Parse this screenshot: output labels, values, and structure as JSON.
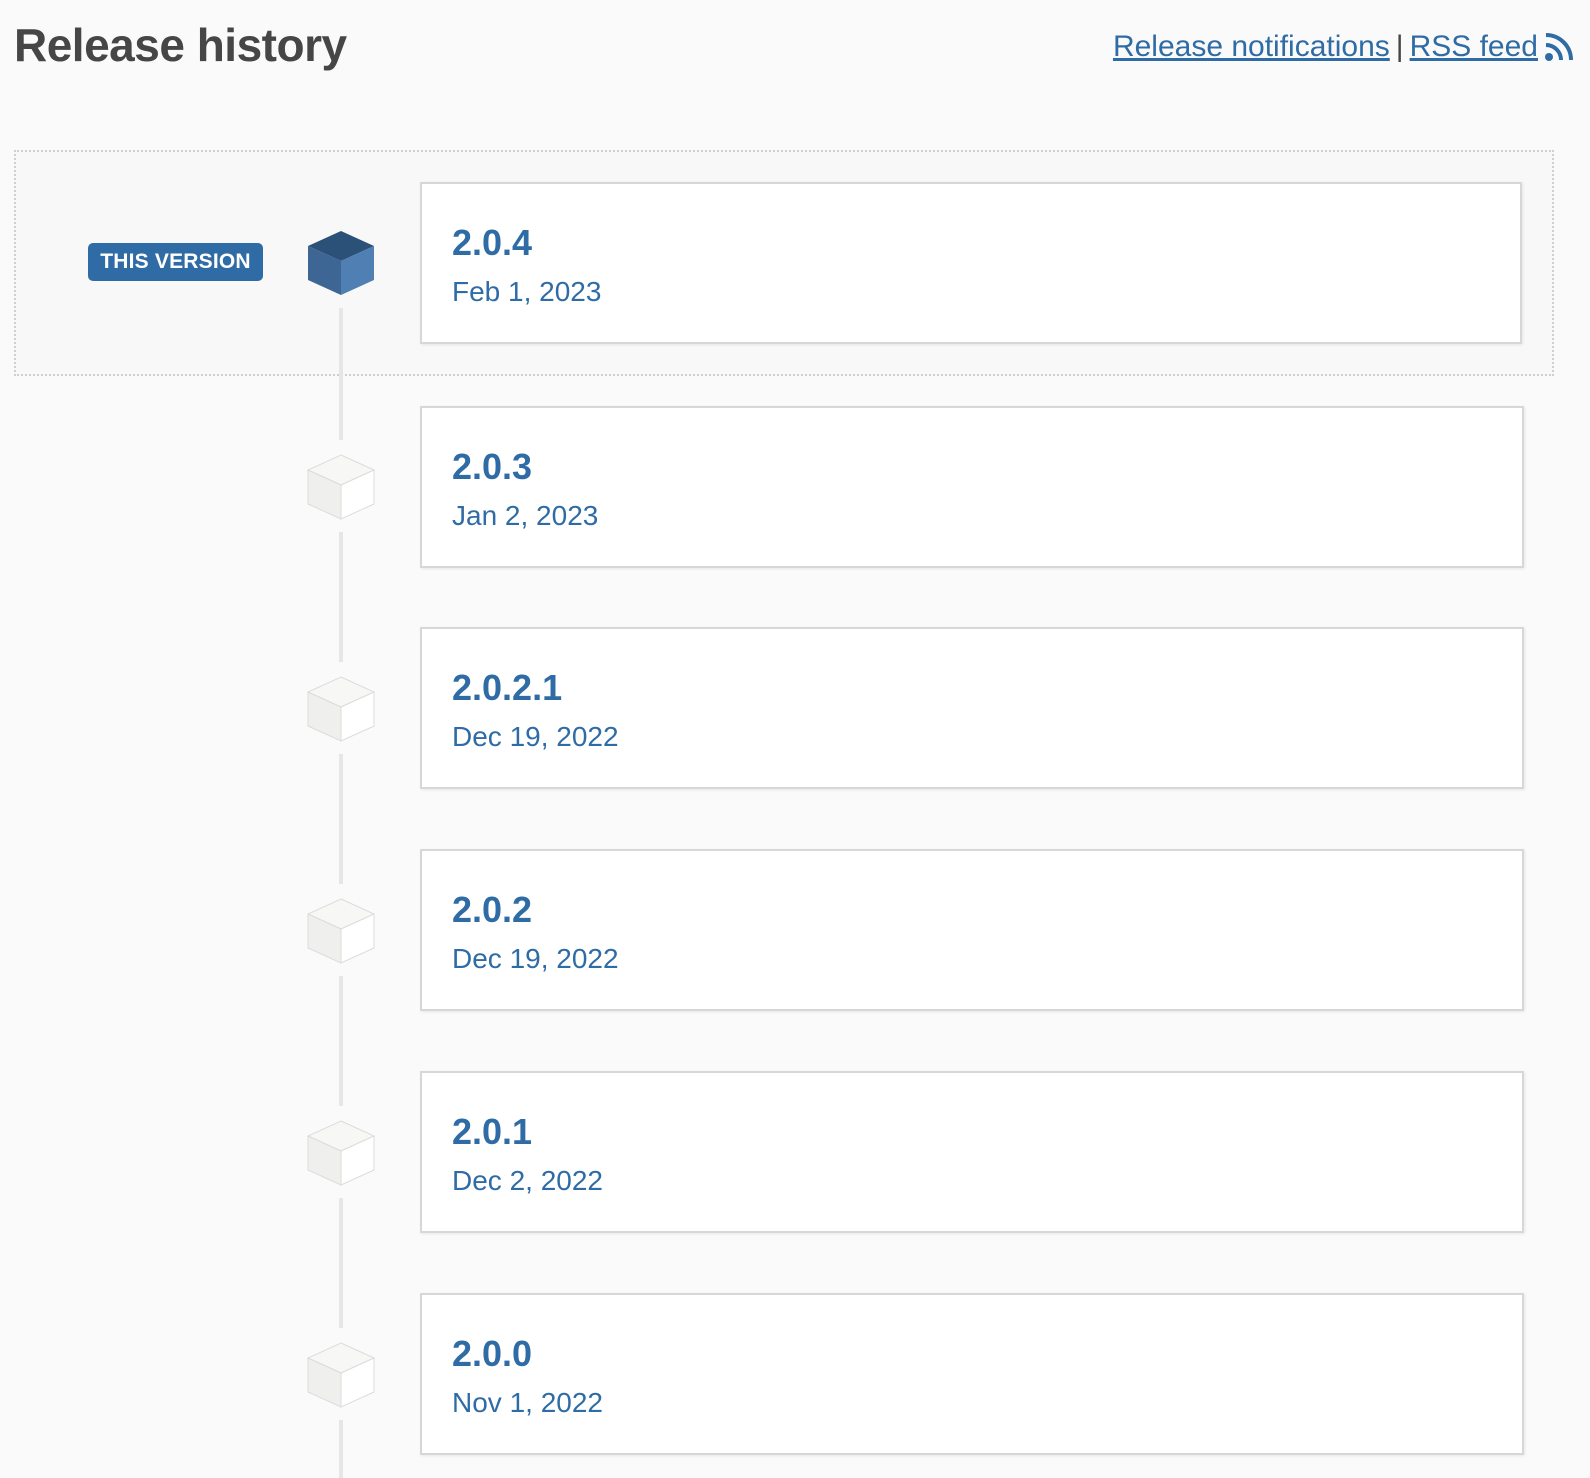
{
  "header": {
    "title": "Release history",
    "notifications_label": "Release notifications",
    "separator": "|",
    "rss_label": "RSS feed"
  },
  "current_badge": "THIS VERSION",
  "colors": {
    "accent": "#2f6ca5",
    "cube_active": "#3d6694",
    "cube_inactive": "#efefed"
  },
  "releases": [
    {
      "version": "2.0.4",
      "date": "Feb 1, 2023",
      "current": true
    },
    {
      "version": "2.0.3",
      "date": "Jan 2, 2023",
      "current": false
    },
    {
      "version": "2.0.2.1",
      "date": "Dec 19, 2022",
      "current": false
    },
    {
      "version": "2.0.2",
      "date": "Dec 19, 2022",
      "current": false
    },
    {
      "version": "2.0.1",
      "date": "Dec 2, 2022",
      "current": false
    },
    {
      "version": "2.0.0",
      "date": "Nov 1, 2022",
      "current": false
    }
  ]
}
